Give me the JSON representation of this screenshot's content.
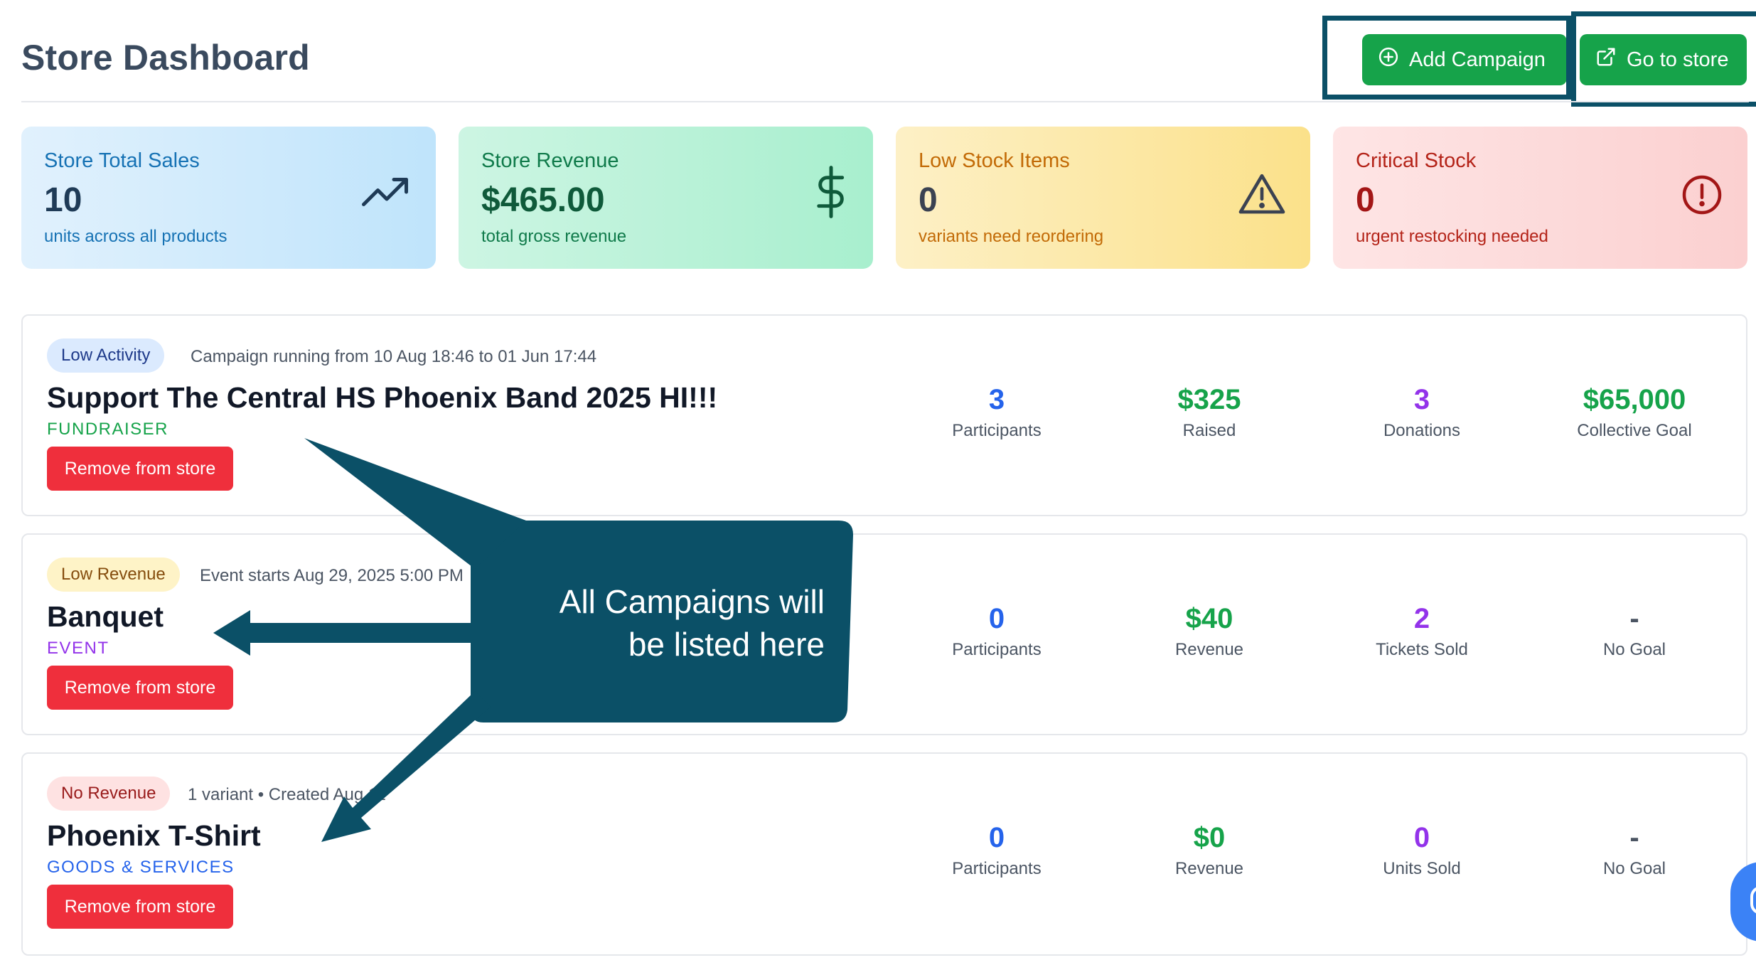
{
  "header": {
    "title": "Store Dashboard",
    "add_campaign_label": "Add Campaign",
    "go_to_store_label": "Go to store",
    "add_icon": "plus-circle-icon",
    "store_icon": "external-link-icon"
  },
  "stats": [
    {
      "label": "Store Total Sales",
      "value": "10",
      "sub": "units across all products",
      "icon": "trending-up-icon"
    },
    {
      "label": "Store Revenue",
      "value": "$465.00",
      "sub": "total gross revenue",
      "icon": "dollar-icon"
    },
    {
      "label": "Low Stock Items",
      "value": "0",
      "sub": "variants need reordering",
      "icon": "warning-triangle-icon"
    },
    {
      "label": "Critical Stock",
      "value": "0",
      "sub": "urgent restocking needed",
      "icon": "alert-circle-icon"
    }
  ],
  "campaigns": [
    {
      "badge": "Low Activity",
      "meta": "Campaign running from 10 Aug 18:46 to 01 Jun 17:44",
      "title": "Support The Central HS Phoenix Band 2025 HI!!!",
      "type": "FUNDRAISER",
      "remove_label": "Remove from store",
      "metrics": [
        {
          "value": "3",
          "label": "Participants"
        },
        {
          "value": "$325",
          "label": "Raised"
        },
        {
          "value": "3",
          "label": "Donations"
        },
        {
          "value": "$65,000",
          "label": "Collective Goal"
        }
      ]
    },
    {
      "badge": "Low Revenue",
      "meta": "Event starts Aug 29, 2025 5:00 PM",
      "title": "Banquet",
      "type": "EVENT",
      "remove_label": "Remove from store",
      "metrics": [
        {
          "value": "0",
          "label": "Participants"
        },
        {
          "value": "$40",
          "label": "Revenue"
        },
        {
          "value": "2",
          "label": "Tickets Sold"
        },
        {
          "value": "-",
          "label": "No Goal"
        }
      ]
    },
    {
      "badge": "No Revenue",
      "meta": "1 variant • Created Aug 11",
      "title": "Phoenix T-Shirt",
      "type": "GOODS & SERVICES",
      "remove_label": "Remove from store",
      "metrics": [
        {
          "value": "0",
          "label": "Participants"
        },
        {
          "value": "$0",
          "label": "Revenue"
        },
        {
          "value": "0",
          "label": "Units Sold"
        },
        {
          "value": "-",
          "label": "No Goal"
        }
      ]
    }
  ],
  "annotation": {
    "line1": "All Campaigns will",
    "line2": "be listed here"
  },
  "colors": {
    "primary_green": "#16a34a",
    "danger_red": "#ef2f3c",
    "annotation_teal": "#0b5067"
  }
}
